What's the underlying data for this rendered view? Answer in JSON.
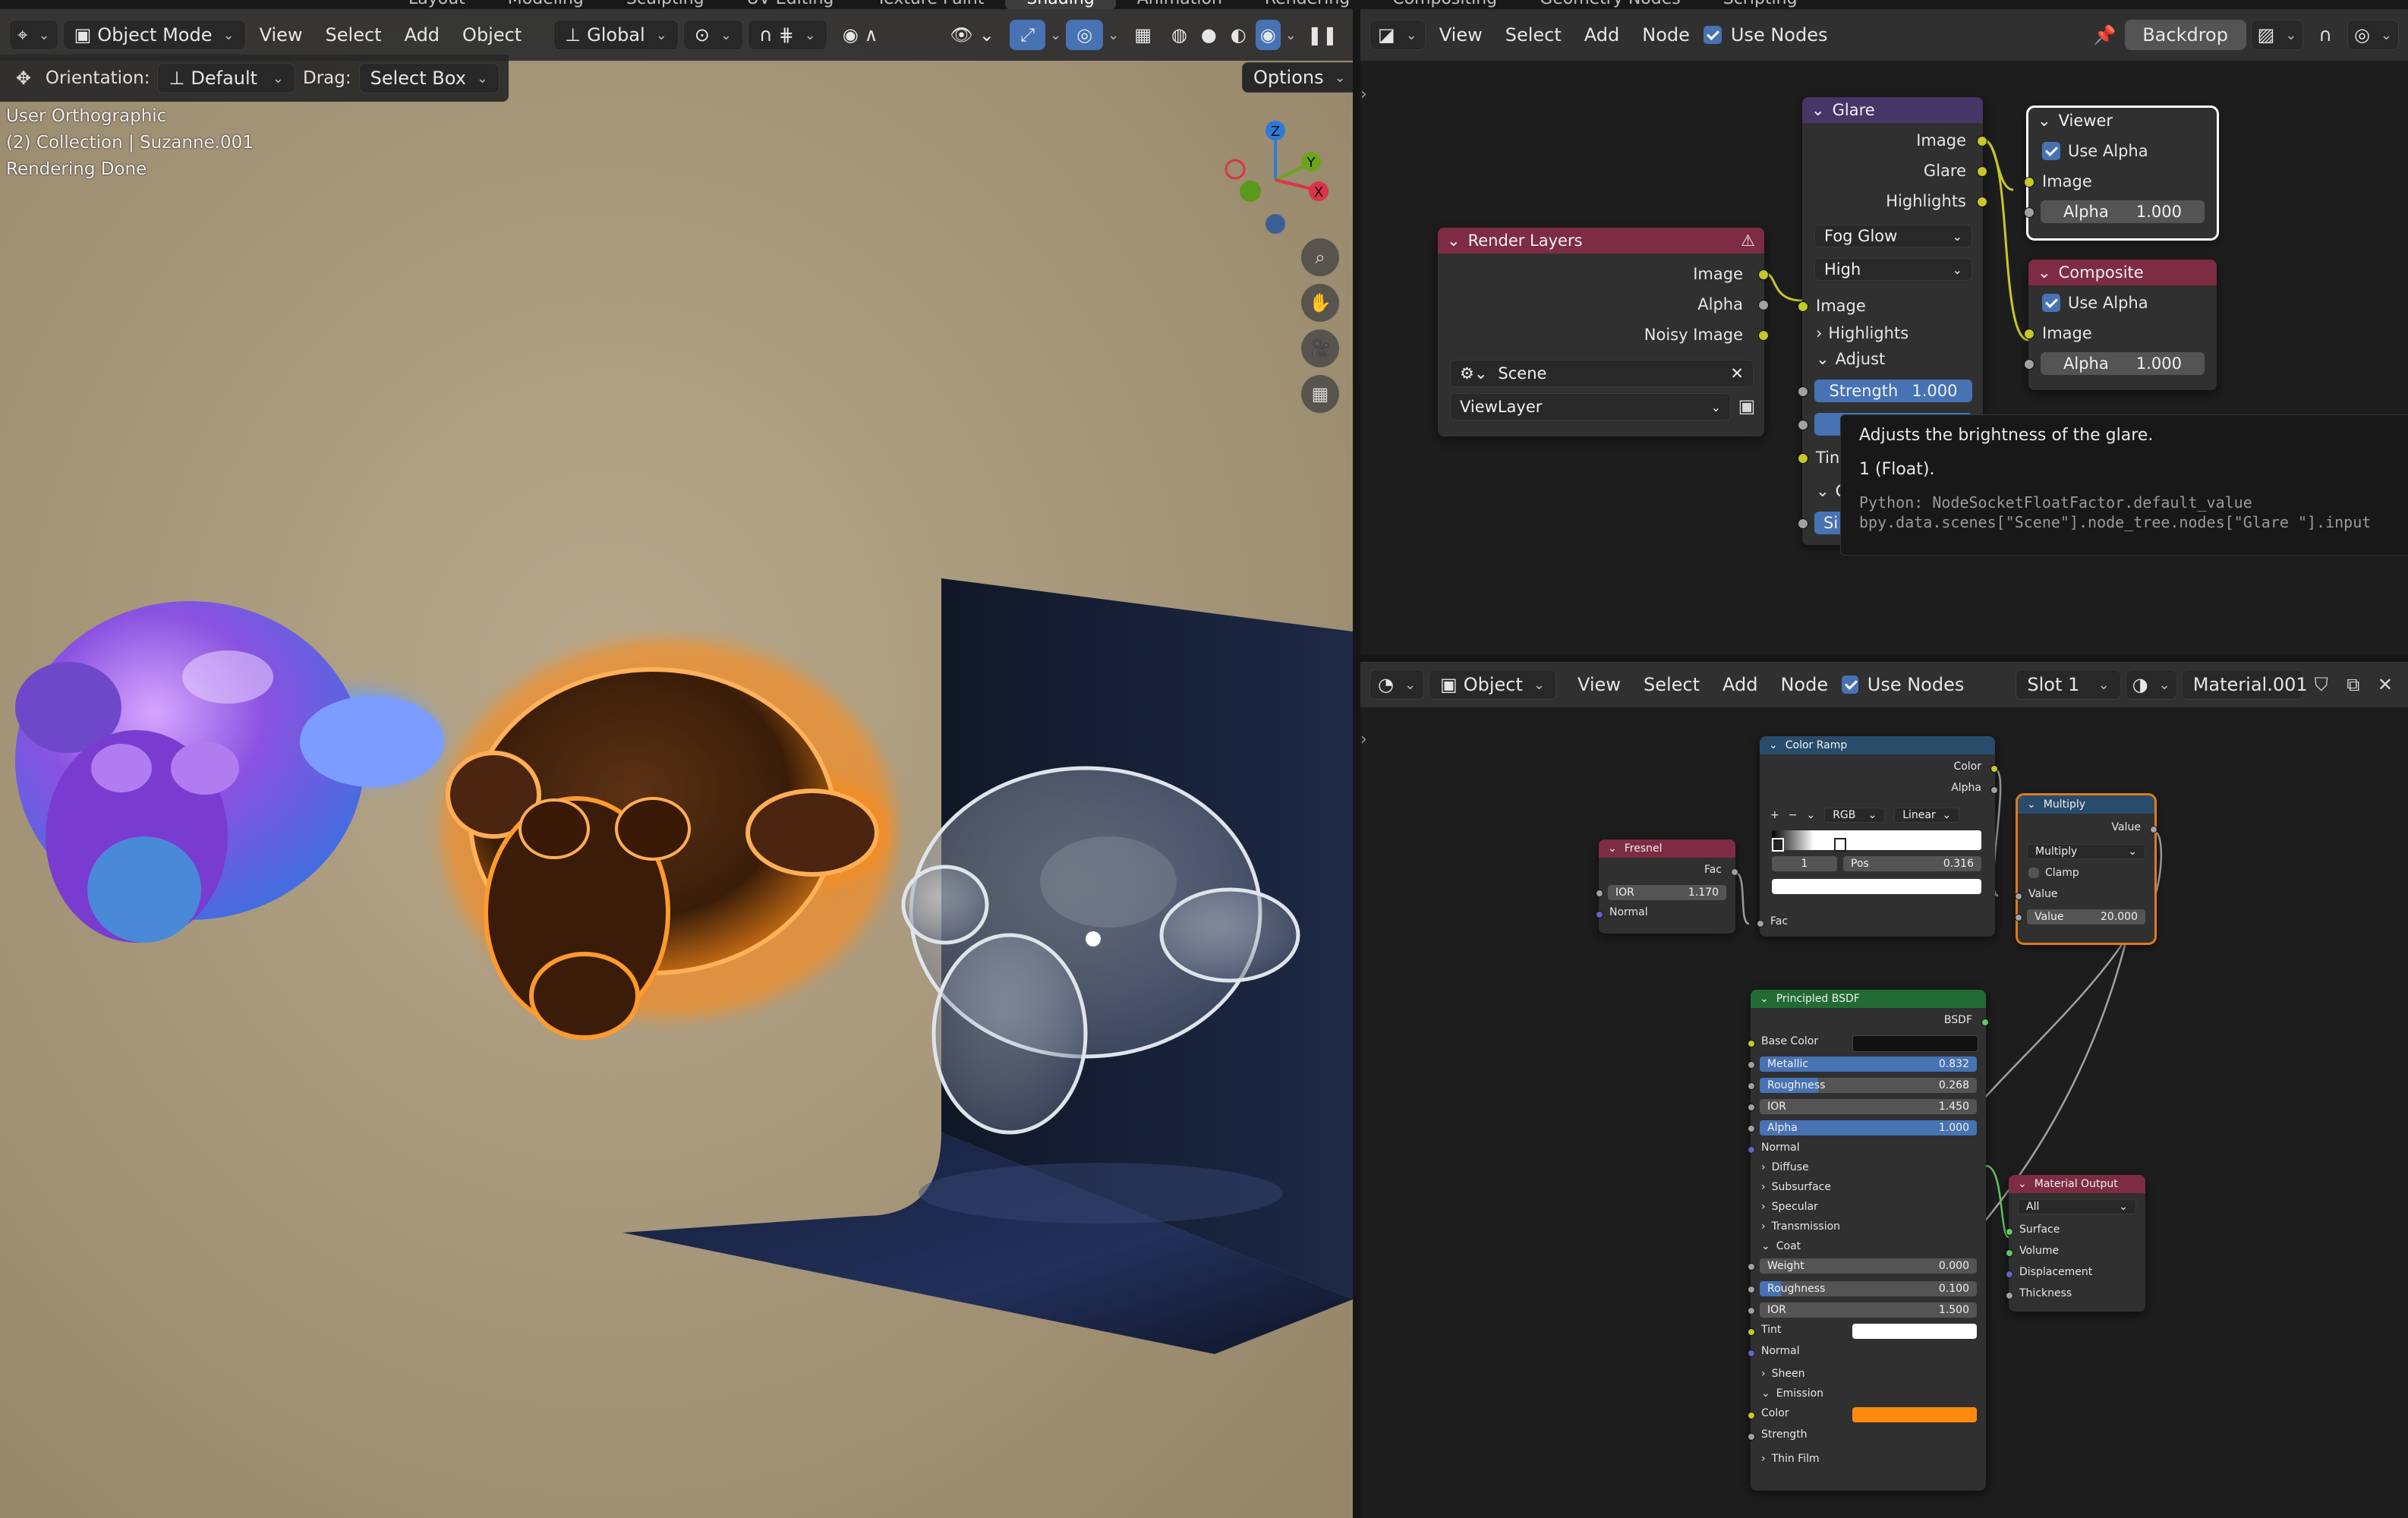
{
  "top_tabs": [
    "Layout",
    "Modeling",
    "Sculpting",
    "UV Editing",
    "Texture Paint",
    "Shading",
    "Animation",
    "Rendering",
    "Compositing",
    "Geometry Nodes",
    "Scripting"
  ],
  "top_tabs_active": "Shading",
  "viewport": {
    "mode": "Object Mode",
    "menus": [
      "View",
      "Select",
      "Add",
      "Object"
    ],
    "transform_orientation": "Global",
    "tool_orientation_label": "Orientation:",
    "tool_orientation_value": "Default",
    "drag_label": "Drag:",
    "drag_value": "Select Box",
    "options_label": "Options",
    "overlay_lines": [
      "User Orthographic",
      "(2) Collection | Suzanne.001",
      "Rendering Done"
    ],
    "gizmo": {
      "z": "Z",
      "y": "Y",
      "x": "X"
    },
    "colors": {
      "background": "#a7987d",
      "plane": "#16213a"
    }
  },
  "compositor": {
    "menus": [
      "View",
      "Select",
      "Add",
      "Node"
    ],
    "use_nodes_label": "Use Nodes",
    "backdrop_label": "Backdrop",
    "render_layers": {
      "title": "Render Layers",
      "outputs": [
        "Image",
        "Alpha",
        "Noisy Image"
      ],
      "scene": "Scene",
      "view_layer": "ViewLayer"
    },
    "glare": {
      "title": "Glare",
      "outputs": [
        "Image",
        "Glare",
        "Highlights"
      ],
      "type": "Fog Glow",
      "quality": "High",
      "input_image": "Image",
      "highlights_label": "Highlights",
      "adjust_label": "Adjust",
      "strength_label": "Strength",
      "strength_value": "1.000",
      "tint_label": "Tint",
      "glow_label": "Gl",
      "size_label": "Si"
    },
    "viewer": {
      "title": "Viewer",
      "use_alpha": "Use Alpha",
      "image": "Image",
      "alpha_label": "Alpha",
      "alpha_value": "1.000"
    },
    "composite": {
      "title": "Composite",
      "use_alpha": "Use Alpha",
      "image": "Image",
      "alpha_label": "Alpha",
      "alpha_value": "1.000"
    },
    "tooltip": {
      "line1": "Adjusts the brightness of the glare.",
      "line2": "1 (Float).",
      "python1": "Python: NodeSocketFloatFactor.default_value",
      "python2": "bpy.data.scenes[\"Scene\"].node_tree.nodes[\"Glare \"].input"
    }
  },
  "shader": {
    "editor_type": "Object",
    "menus": [
      "View",
      "Select",
      "Add",
      "Node"
    ],
    "use_nodes_label": "Use Nodes",
    "slot": "Slot 1",
    "material": "Material.001",
    "color_ramp": {
      "title": "Color Ramp",
      "out_color": "Color",
      "out_alpha": "Alpha",
      "mode": "RGB",
      "interp": "Linear",
      "stop_index": "1",
      "pos_label": "Pos",
      "pos_value": "0.316",
      "in_fac": "Fac"
    },
    "fresnel": {
      "title": "Fresnel",
      "out_fac": "Fac",
      "ior_label": "IOR",
      "ior_value": "1.170",
      "normal": "Normal"
    },
    "multiply": {
      "title": "Multiply",
      "out_value": "Value",
      "operation": "Multiply",
      "clamp": "Clamp",
      "in_value": "Value",
      "value_label": "Value",
      "value_value": "20.000"
    },
    "principled": {
      "title": "Principled BSDF",
      "out_bsdf": "BSDF",
      "base_color": "Base Color",
      "metallic_label": "Metallic",
      "metallic_value": "0.832",
      "roughness_label": "Roughness",
      "roughness_value": "0.268",
      "ior_label": "IOR",
      "ior_value": "1.450",
      "alpha_label": "Alpha",
      "alpha_value": "1.000",
      "normal": "Normal",
      "sections": [
        "Diffuse",
        "Subsurface",
        "Specular",
        "Transmission"
      ],
      "coat": "Coat",
      "coat_weight_label": "Weight",
      "coat_weight_value": "0.000",
      "coat_rough_label": "Roughness",
      "coat_rough_value": "0.100",
      "coat_ior_label": "IOR",
      "coat_ior_value": "1.500",
      "coat_tint": "Tint",
      "coat_normal": "Normal",
      "sheen": "Sheen",
      "emission": "Emission",
      "em_color": "Color",
      "em_strength": "Strength",
      "thin_film": "Thin Film",
      "emission_color": "#ff8a0e"
    },
    "output": {
      "title": "Material Output",
      "target": "All",
      "surface": "Surface",
      "volume": "Volume",
      "displacement": "Displacement",
      "thickness": "Thickness"
    }
  }
}
